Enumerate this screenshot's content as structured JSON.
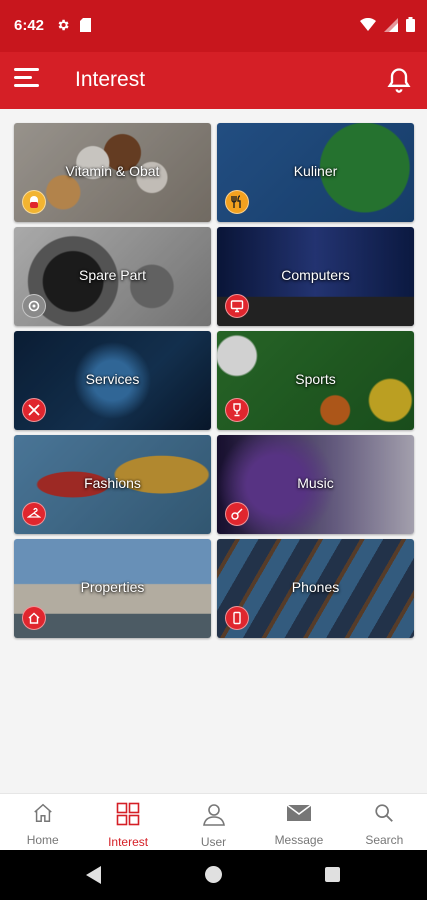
{
  "status_bar": {
    "time": "6:42"
  },
  "app_bar": {
    "title": "Interest"
  },
  "categories": [
    {
      "label": "Vitamin & Obat",
      "icon": "pill-icon"
    },
    {
      "label": "Kuliner",
      "icon": "food-icon"
    },
    {
      "label": "Spare Part",
      "icon": "gear-part-icon"
    },
    {
      "label": "Computers",
      "icon": "monitor-icon"
    },
    {
      "label": "Services",
      "icon": "tools-icon"
    },
    {
      "label": "Sports",
      "icon": "trophy-icon"
    },
    {
      "label": "Fashions",
      "icon": "hanger-icon"
    },
    {
      "label": "Music",
      "icon": "guitar-icon"
    },
    {
      "label": "Properties",
      "icon": "house-icon"
    },
    {
      "label": "Phones",
      "icon": "phone-icon"
    }
  ],
  "bottom_nav": [
    {
      "label": "Home",
      "icon": "home-icon"
    },
    {
      "label": "Interest",
      "icon": "grid-icon",
      "active": true
    },
    {
      "label": "User",
      "icon": "user-icon"
    },
    {
      "label": "Message",
      "icon": "mail-icon"
    },
    {
      "label": "Search",
      "icon": "search-icon"
    }
  ],
  "colors": {
    "primary": "#d51f26",
    "status_bar": "#c8161d",
    "inactive": "#777777"
  }
}
